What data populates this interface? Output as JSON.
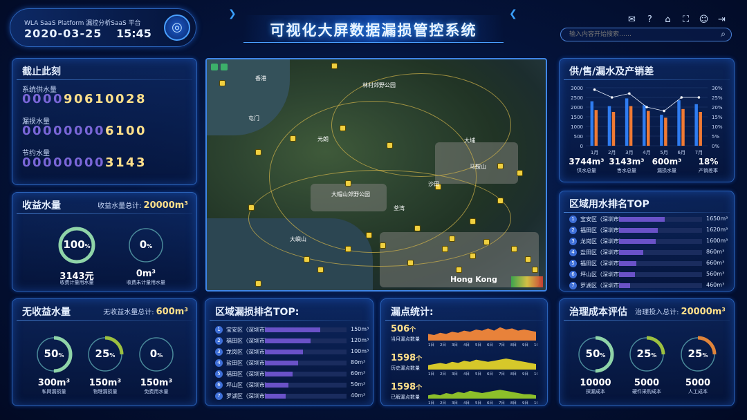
{
  "header": {
    "brand": "WLA  SaaS Platform 漏控分析SaaS 平台",
    "date": "2020-03-25",
    "time": "15:45",
    "title": "可视化大屏数据漏损管控系统",
    "search_placeholder": "输入内容开始搜索……",
    "icons": [
      "message-icon",
      "help-icon",
      "home-icon",
      "fullscreen-icon",
      "user-icon",
      "logout-icon"
    ]
  },
  "counters": {
    "title": "截止此刻",
    "items": [
      {
        "label": "系统供水量",
        "digits": [
          "0",
          "0",
          "0",
          "0",
          "9",
          "0",
          "6",
          "1",
          "0",
          "0",
          "2",
          "8"
        ],
        "lit_from": 4
      },
      {
        "label": "漏损水量",
        "digits": [
          "0",
          "0",
          "0",
          "0",
          "0",
          "0",
          "0",
          "0",
          "6",
          "1",
          "0",
          "0"
        ],
        "lit_from": 8
      },
      {
        "label": "节约水量",
        "digits": [
          "0",
          "0",
          "0",
          "0",
          "0",
          "0",
          "0",
          "0",
          "3",
          "1",
          "4",
          "3"
        ],
        "lit_from": 8
      }
    ]
  },
  "income": {
    "title": "收益水量",
    "total_label": "收益水量总计:",
    "total": "20000m³",
    "rings": [
      {
        "pct": "100",
        "unit": "%",
        "value": "3143元",
        "caption": "收费计量用水量"
      },
      {
        "pct": "0",
        "unit": "%",
        "value": "0m³",
        "caption": "收费未计量用水量"
      }
    ]
  },
  "noincome": {
    "title": "无收益水量",
    "total_label": "无收益水量总计:",
    "total": "600m³",
    "rings": [
      {
        "pct": "50",
        "unit": "%",
        "value": "300m³",
        "caption": "私网漏损量"
      },
      {
        "pct": "25",
        "unit": "%",
        "value": "150m³",
        "caption": "物理漏损量"
      },
      {
        "pct": "0",
        "unit": "%",
        "value": "150m³",
        "caption": "免费用水量"
      }
    ]
  },
  "supply": {
    "title": "供/售/漏水及产销差",
    "stats": [
      {
        "value": "3744m³",
        "caption": "供水总量"
      },
      {
        "value": "3143m³",
        "caption": "售水总量"
      },
      {
        "value": "600m³",
        "caption": "漏损水量"
      },
      {
        "value": "18%",
        "caption": "产销差率"
      }
    ]
  },
  "chart_data": {
    "type": "bar",
    "categories": [
      "1月",
      "2月",
      "3月",
      "4月",
      "5月",
      "6月",
      "7月"
    ],
    "series": [
      {
        "values": [
          2300,
          2050,
          2450,
          2100,
          1600,
          2350,
          2150
        ],
        "color": "#2f7cf0"
      },
      {
        "values": [
          1850,
          1750,
          2050,
          1800,
          1450,
          1900,
          1750
        ],
        "color": "#f07a34"
      },
      {
        "values": [
          29,
          25,
          27,
          20,
          18,
          25,
          25
        ],
        "color": "#ffffff",
        "axis": "right"
      }
    ],
    "ylim": [
      0,
      3000
    ],
    "yticks": [
      0,
      500,
      1000,
      1500,
      2000,
      2500,
      3000
    ],
    "y2lim": [
      0,
      30
    ],
    "y2ticks": [
      "0%",
      "5%",
      "10%",
      "15%",
      "20%",
      "25%",
      "30%"
    ]
  },
  "region_use": {
    "title": "区域用水排名TOP",
    "rows": [
      {
        "rank": "1",
        "name": "宝安区（深圳市）",
        "value": "1650m³",
        "frac": 0.55
      },
      {
        "rank": "2",
        "name": "福田区（深圳市）",
        "value": "1620m³",
        "frac": 0.47
      },
      {
        "rank": "3",
        "name": "龙岗区（深圳市）",
        "value": "1600m³",
        "frac": 0.44
      },
      {
        "rank": "4",
        "name": "盐田区（深圳市）",
        "value": "860m³",
        "frac": 0.29
      },
      {
        "rank": "5",
        "name": "福田区（深圳市）",
        "value": "660m³",
        "frac": 0.21
      },
      {
        "rank": "6",
        "name": "坪山区（深圳市）",
        "value": "560m³",
        "frac": 0.19
      },
      {
        "rank": "7",
        "name": "罗湖区（深圳市）",
        "value": "460m³",
        "frac": 0.13
      }
    ]
  },
  "region_leak": {
    "title": "区域漏损排名TOP:",
    "rows": [
      {
        "rank": "1",
        "name": "宝安区（深圳市）",
        "value": "150m³",
        "frac": 0.68
      },
      {
        "rank": "2",
        "name": "福田区（深圳市）",
        "value": "120m³",
        "frac": 0.56
      },
      {
        "rank": "3",
        "name": "龙岗区（深圳市）",
        "value": "100m³",
        "frac": 0.47
      },
      {
        "rank": "4",
        "name": "盐田区（深圳市）",
        "value": "80m³",
        "frac": 0.41
      },
      {
        "rank": "5",
        "name": "福田区（深圳市）",
        "value": "60m³",
        "frac": 0.34
      },
      {
        "rank": "6",
        "name": "坪山区（深圳市）",
        "value": "50m³",
        "frac": 0.29
      },
      {
        "rank": "7",
        "name": "罗湖区（深圳市）",
        "value": "40m³",
        "frac": 0.25
      }
    ]
  },
  "leak_stats": {
    "title": "漏点统计:",
    "xlabels": [
      "1日",
      "2日",
      "3日",
      "4日",
      "5日",
      "6日",
      "7日",
      "8日",
      "9日",
      "10日"
    ],
    "rows": [
      {
        "num": "506",
        "unit": "个",
        "caption": "当月漏点数量",
        "color": "#e8823a"
      },
      {
        "num": "1598",
        "unit": "个",
        "caption": "历史漏点数量",
        "color": "#d6c82a"
      },
      {
        "num": "1598",
        "unit": "个",
        "caption": "已解漏点数量",
        "color": "#8cbf2a"
      }
    ]
  },
  "cost": {
    "title": "治理成本评估",
    "total_label": "治理投入总计:",
    "total": "20000m³",
    "rings": [
      {
        "pct": "50",
        "unit": "%",
        "value": "10000",
        "caption": "探漏成本"
      },
      {
        "pct": "25",
        "unit": "%",
        "value": "5000",
        "caption": "硬件采购成本"
      },
      {
        "pct": "25",
        "unit": "%",
        "value": "5000",
        "caption": "人工成本"
      }
    ]
  },
  "map": {
    "labels": [
      "香港",
      "林村郊野公园",
      "大埔",
      "马鞍山",
      "大帽山郊野公园",
      "荃湾",
      "屯门",
      "大嶼山",
      "元朗",
      "沙田",
      "Hong Kong"
    ]
  }
}
